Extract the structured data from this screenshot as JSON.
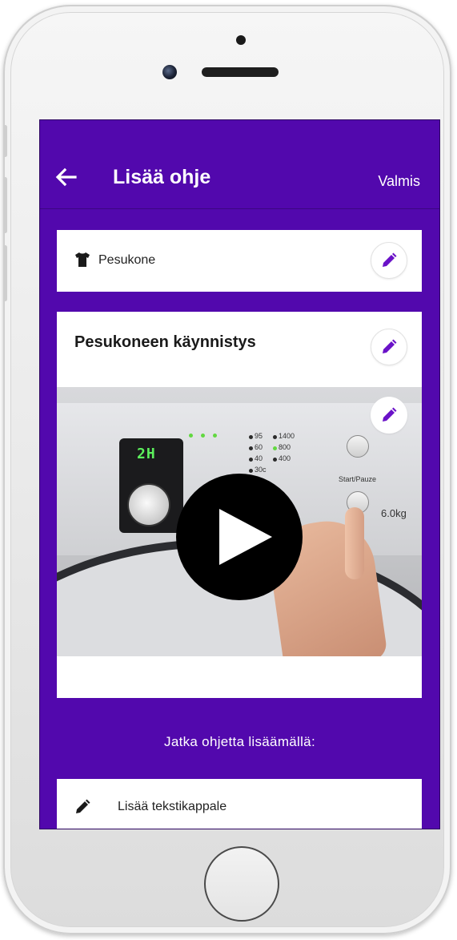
{
  "appbar": {
    "title": "Lisää ohje",
    "action_label": "Valmis",
    "back_icon": "arrow-left-icon"
  },
  "category_card": {
    "icon": "shirt-icon",
    "label": "Pesukone",
    "edit_icon": "pencil-icon"
  },
  "step_card": {
    "title": "Pesukoneen käynnistys",
    "edit_icon": "pencil-icon",
    "video": {
      "play_icon": "play-icon",
      "display_text": "2H",
      "spin_speeds": [
        "1400",
        "800",
        "400"
      ],
      "temperatures": [
        "95",
        "60",
        "40",
        "30c"
      ],
      "capacity_label": "6.0kg",
      "start_pause_label": "Start/Pauze"
    }
  },
  "continue_label": "Jatka ohjetta lisäämällä:",
  "add_text_card": {
    "icon": "pencil-icon",
    "label": "Lisää tekstikappale"
  },
  "colors": {
    "primary": "#5208ad",
    "accent_edit": "#6a12c8",
    "card": "#ffffff"
  }
}
